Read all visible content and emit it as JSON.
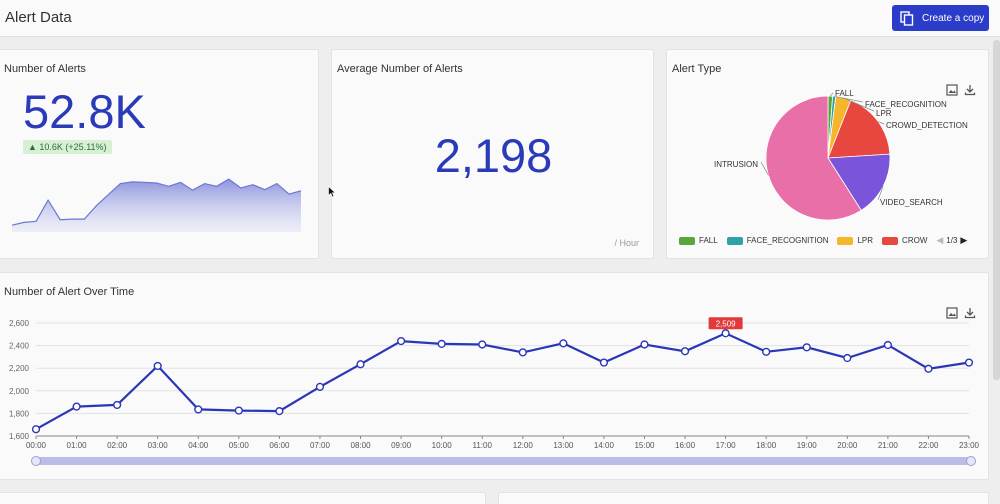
{
  "header": {
    "title": "Alert Data",
    "copy_button_label": "Create a copy"
  },
  "alerts_card": {
    "title": "Number of Alerts",
    "value": "52.8K",
    "delta": "▲ 10.6K (+25.11%)",
    "sparkline_values": [
      1650,
      1700,
      1720,
      2100,
      1750,
      1760,
      1760,
      2000,
      2200,
      2400,
      2430,
      2420,
      2410,
      2350,
      2420,
      2280,
      2400,
      2350,
      2480,
      2320,
      2380,
      2290,
      2400,
      2210,
      2270
    ]
  },
  "average_card": {
    "title": "Average Number of Alerts",
    "value": "2,198",
    "unit": "/ Hour"
  },
  "alert_type_card": {
    "title": "Alert Type",
    "image_icon": "image-icon",
    "download_icon": "download-icon",
    "legend": [
      {
        "label": "FALL",
        "color": "#5aa63c"
      },
      {
        "label": "FACE_RECOGNITION",
        "color": "#2ba3a8"
      },
      {
        "label": "LPR",
        "color": "#f5b62b"
      },
      {
        "label": "CROW",
        "color": "#e8473f"
      }
    ],
    "legend_page": "1/3"
  },
  "over_time_card": {
    "title": "Number of Alert Over Time",
    "tooltip_value": "2,509"
  },
  "chart_data": [
    {
      "type": "pie",
      "title": "Alert Type",
      "slices": [
        {
          "label": "FALL",
          "value": 1.2,
          "color": "#5aa63c"
        },
        {
          "label": "FACE_RECOGNITION",
          "value": 0.8,
          "color": "#2ba3a8"
        },
        {
          "label": "LPR",
          "value": 4,
          "color": "#f5b62b"
        },
        {
          "label": "CROWD_DETECTION",
          "value": 18,
          "color": "#e8473f"
        },
        {
          "label": "VIDEO_SEARCH",
          "value": 17,
          "color": "#7b55d9"
        },
        {
          "label": "INTRUSION",
          "value": 59,
          "color": "#e86fa8"
        }
      ]
    },
    {
      "type": "line",
      "title": "Number of Alert Over Time",
      "x": [
        "00:00",
        "01:00",
        "02:00",
        "03:00",
        "04:00",
        "05:00",
        "06:00",
        "07:00",
        "08:00",
        "09:00",
        "10:00",
        "11:00",
        "12:00",
        "13:00",
        "14:00",
        "15:00",
        "16:00",
        "17:00",
        "18:00",
        "19:00",
        "20:00",
        "21:00",
        "22:00",
        "23:00"
      ],
      "series": [
        {
          "values": [
            1660,
            1860,
            1875,
            2220,
            1835,
            1825,
            1820,
            2035,
            2235,
            2440,
            2415,
            2410,
            2340,
            2420,
            2250,
            2410,
            2350,
            2509,
            2345,
            2385,
            2290,
            2405,
            2195,
            2250
          ]
        }
      ],
      "y_ticks": [
        "1,600",
        "1,800",
        "2,000",
        "2,200",
        "2,400",
        "2,600"
      ],
      "ylim": [
        1600,
        2600
      ],
      "grid": true,
      "color": "#2a36b8"
    }
  ]
}
